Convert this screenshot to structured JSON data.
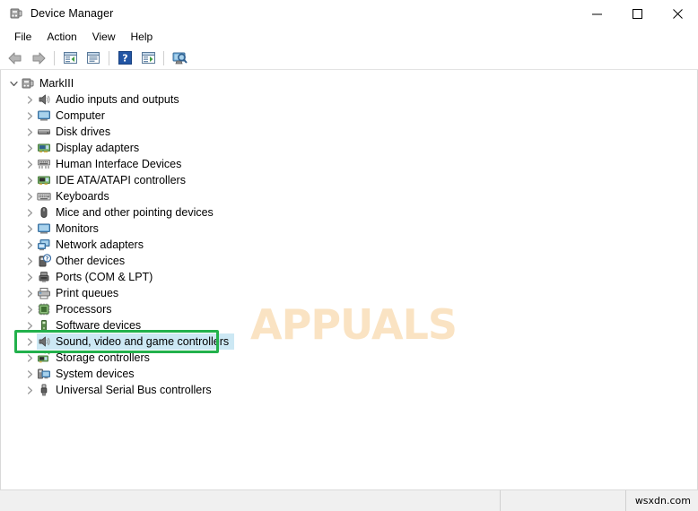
{
  "window": {
    "title": "Device Manager",
    "title_icon": "device-manager-icon",
    "controls": [
      {
        "name": "minimize-button",
        "glyph": "minimize"
      },
      {
        "name": "maximize-button",
        "glyph": "maximize"
      },
      {
        "name": "close-button",
        "glyph": "close"
      }
    ]
  },
  "menubar": {
    "items": [
      {
        "label": "File",
        "name": "menu-file"
      },
      {
        "label": "Action",
        "name": "menu-action"
      },
      {
        "label": "View",
        "name": "menu-view"
      },
      {
        "label": "Help",
        "name": "menu-help"
      }
    ]
  },
  "toolbar": {
    "buttons": [
      {
        "name": "back-button",
        "icon": "back-arrow-icon"
      },
      {
        "name": "forward-button",
        "icon": "forward-arrow-icon"
      },
      {
        "name": "separator-1",
        "icon": "separator"
      },
      {
        "name": "show-hidden-devices-button",
        "icon": "window-list-icon"
      },
      {
        "name": "properties-button",
        "icon": "properties-icon"
      },
      {
        "name": "separator-2",
        "icon": "separator"
      },
      {
        "name": "help-button",
        "icon": "help-question-icon"
      },
      {
        "name": "update-driver-button",
        "icon": "window-play-icon"
      },
      {
        "name": "separator-3",
        "icon": "separator"
      },
      {
        "name": "scan-hardware-changes-button",
        "icon": "monitor-scan-icon"
      }
    ]
  },
  "tree": {
    "root": {
      "label": "MarkIII",
      "icon": "computer-tower-icon",
      "expanded": true
    },
    "items": [
      {
        "label": "Audio inputs and outputs",
        "icon": "speaker-icon",
        "selected": false
      },
      {
        "label": "Computer",
        "icon": "monitor-icon",
        "selected": false
      },
      {
        "label": "Disk drives",
        "icon": "disk-drive-icon",
        "selected": false
      },
      {
        "label": "Display adapters",
        "icon": "display-adapter-icon",
        "selected": false
      },
      {
        "label": "Human Interface Devices",
        "icon": "hid-icon",
        "selected": false
      },
      {
        "label": "IDE ATA/ATAPI controllers",
        "icon": "ide-controller-icon",
        "selected": false
      },
      {
        "label": "Keyboards",
        "icon": "keyboard-icon",
        "selected": false
      },
      {
        "label": "Mice and other pointing devices",
        "icon": "mouse-icon",
        "selected": false
      },
      {
        "label": "Monitors",
        "icon": "monitor-icon",
        "selected": false
      },
      {
        "label": "Network adapters",
        "icon": "network-adapter-icon",
        "selected": false
      },
      {
        "label": "Other devices",
        "icon": "other-device-icon",
        "selected": false
      },
      {
        "label": "Ports (COM & LPT)",
        "icon": "port-icon",
        "selected": false
      },
      {
        "label": "Print queues",
        "icon": "printer-icon",
        "selected": false
      },
      {
        "label": "Processors",
        "icon": "processor-icon",
        "selected": false
      },
      {
        "label": "Software devices",
        "icon": "software-device-icon",
        "selected": false
      },
      {
        "label": "Sound, video and game controllers",
        "icon": "speaker-icon",
        "selected": true
      },
      {
        "label": "Storage controllers",
        "icon": "storage-controller-icon",
        "selected": false
      },
      {
        "label": "System devices",
        "icon": "system-device-icon",
        "selected": false
      },
      {
        "label": "Universal Serial Bus controllers",
        "icon": "usb-icon",
        "selected": false
      }
    ]
  },
  "annotation": {
    "highlight_color": "#22b14c",
    "target_label": "Sound, video and game controllers"
  },
  "watermark": {
    "text": "APPUALS",
    "color": "#f0a63c"
  },
  "statusbar": {
    "left_text": "",
    "middle_text": "",
    "right_text": "wsxdn.com"
  }
}
